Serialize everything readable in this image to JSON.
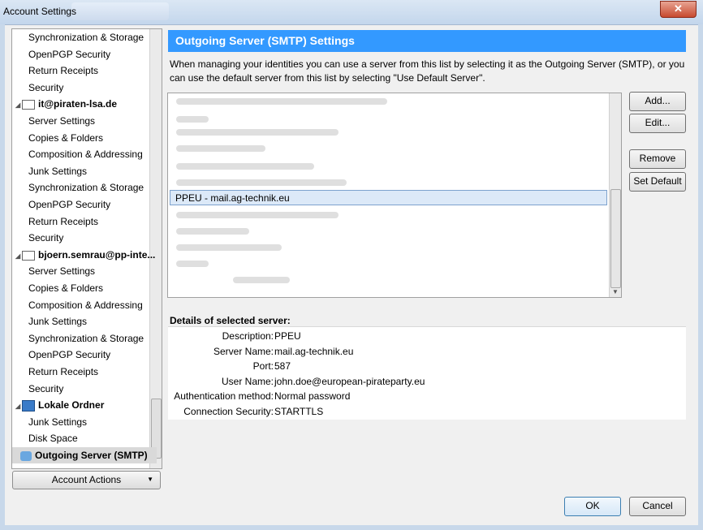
{
  "window": {
    "title": "Account Settings",
    "close_label": "✕"
  },
  "sidebar": {
    "items": [
      {
        "label": "Synchronization & Storage",
        "kind": "child"
      },
      {
        "label": "OpenPGP Security",
        "kind": "child"
      },
      {
        "label": "Return Receipts",
        "kind": "child"
      },
      {
        "label": "Security",
        "kind": "child"
      },
      {
        "label": "it@piraten-lsa.de",
        "kind": "account"
      },
      {
        "label": "Server Settings",
        "kind": "child"
      },
      {
        "label": "Copies & Folders",
        "kind": "child"
      },
      {
        "label": "Composition & Addressing",
        "kind": "child"
      },
      {
        "label": "Junk Settings",
        "kind": "child"
      },
      {
        "label": "Synchronization & Storage",
        "kind": "child"
      },
      {
        "label": "OpenPGP Security",
        "kind": "child"
      },
      {
        "label": "Return Receipts",
        "kind": "child"
      },
      {
        "label": "Security",
        "kind": "child"
      },
      {
        "label": "bjoern.semrau@pp-inte...",
        "kind": "account"
      },
      {
        "label": "Server Settings",
        "kind": "child"
      },
      {
        "label": "Copies & Folders",
        "kind": "child"
      },
      {
        "label": "Composition & Addressing",
        "kind": "child"
      },
      {
        "label": "Junk Settings",
        "kind": "child"
      },
      {
        "label": "Synchronization & Storage",
        "kind": "child"
      },
      {
        "label": "OpenPGP Security",
        "kind": "child"
      },
      {
        "label": "Return Receipts",
        "kind": "child"
      },
      {
        "label": "Security",
        "kind": "child"
      },
      {
        "label": "Lokale Ordner",
        "kind": "local"
      },
      {
        "label": "Junk Settings",
        "kind": "child"
      },
      {
        "label": "Disk Space",
        "kind": "child"
      },
      {
        "label": "Outgoing Server (SMTP)",
        "kind": "selected"
      }
    ],
    "account_actions_label": "Account Actions"
  },
  "main": {
    "header": "Outgoing Server (SMTP) Settings",
    "description": "When managing your identities you can use a server from this list by selecting it as the Outgoing Server (SMTP), or you can use the default server from this list by selecting \"Use Default Server\".",
    "selected_server": "PPEU - mail.ag-technik.eu",
    "buttons": {
      "add": "Add...",
      "edit": "Edit...",
      "remove": "Remove",
      "set_default": "Set Default"
    },
    "details_title": "Details of selected server:",
    "details": [
      {
        "label": "Description:",
        "value": "PPEU"
      },
      {
        "label": "Server Name:",
        "value": "mail.ag-technik.eu"
      },
      {
        "label": "Port:",
        "value": "587"
      },
      {
        "label": "User Name:",
        "value": "john.doe@european-pirateparty.eu"
      },
      {
        "label": "Authentication method:",
        "value": "Normal password"
      },
      {
        "label": "Connection Security:",
        "value": "STARTTLS"
      }
    ]
  },
  "footer": {
    "ok": "OK",
    "cancel": "Cancel"
  }
}
